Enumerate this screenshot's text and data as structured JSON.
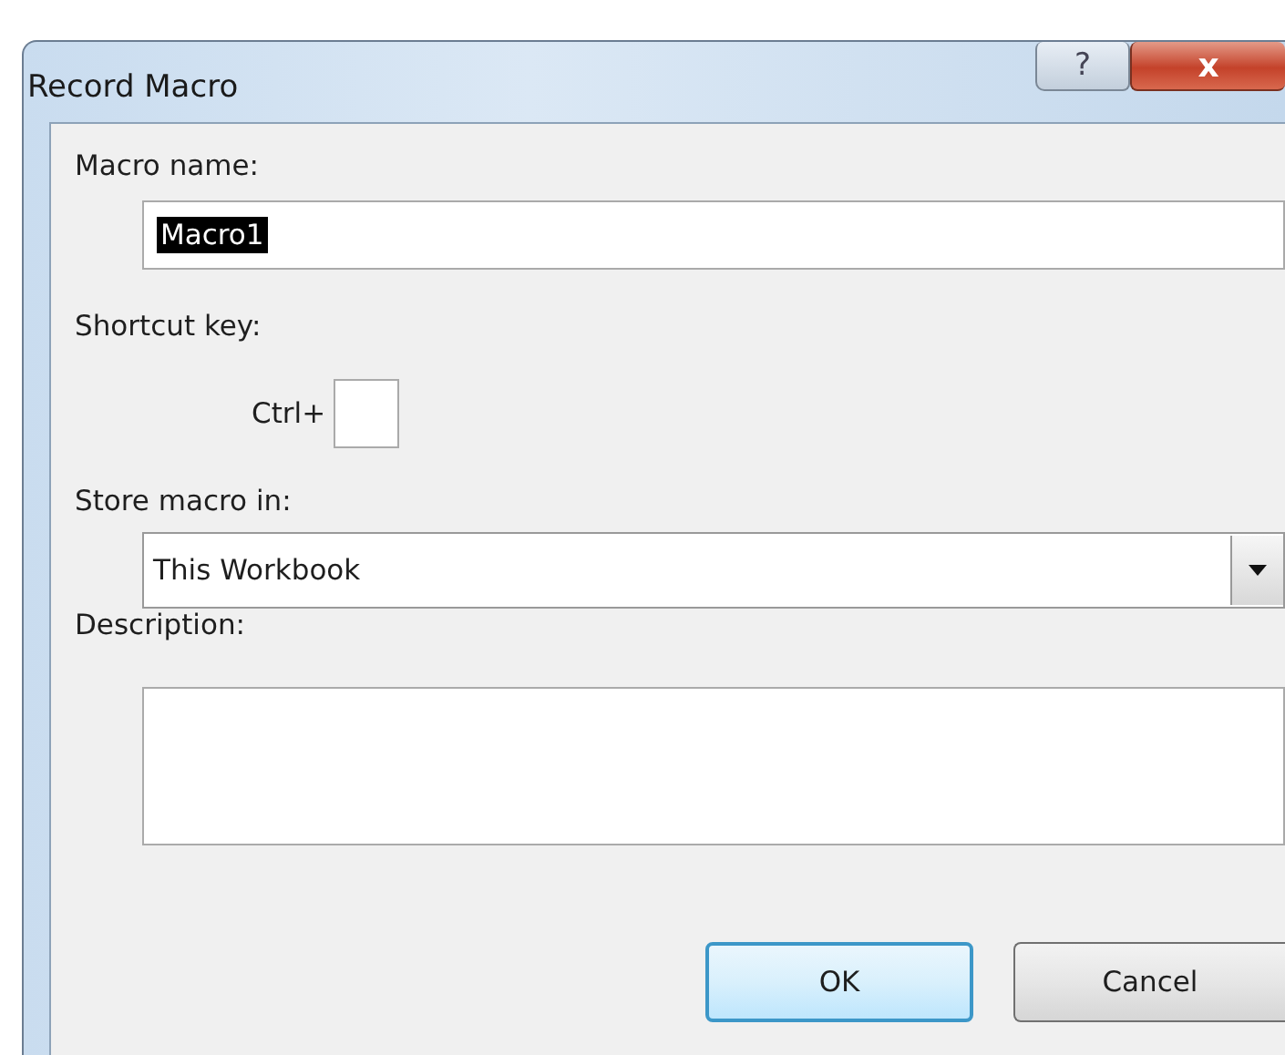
{
  "window": {
    "title": "Record Macro",
    "help_button": "?",
    "close_button": "x"
  },
  "macro_name": {
    "label": "Macro name:",
    "value": "Macro1",
    "selected": true
  },
  "shortcut_key": {
    "label": "Shortcut key:",
    "prefix": "Ctrl+"
  },
  "store_macro_in": {
    "label": "Store macro in:",
    "value": "This Workbook"
  },
  "description": {
    "label": "Description:"
  },
  "buttons": [
    {
      "label": "OK",
      "default": true
    },
    {
      "label": "Cancel",
      "default": false
    }
  ]
}
